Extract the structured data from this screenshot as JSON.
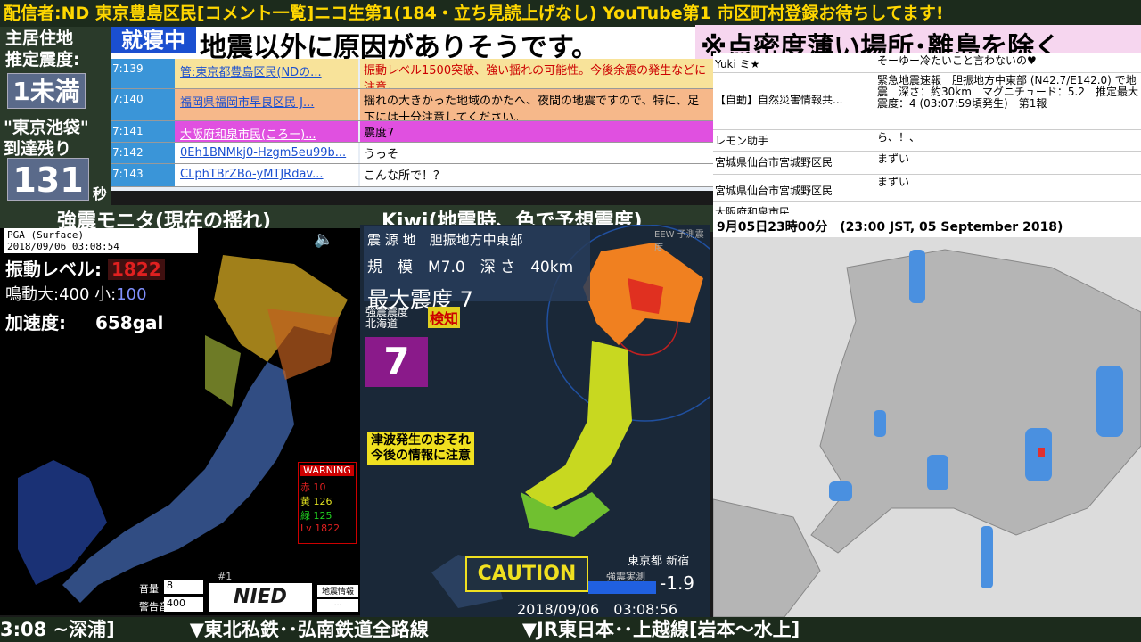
{
  "top_ticker": "配信者:ND 東京豊島区民[コメント一覧]ニコ生第1(184・立ち見読上げなし) YouTube第1 市区町村登録お待ちしてます!",
  "left": {
    "line1": "主居住地",
    "line2": "推定震度:",
    "intensity": "1未満",
    "line3": "\"東京池袋\"",
    "line4": "到達残り",
    "countdown": "131",
    "unit": "秒"
  },
  "banner": {
    "status": "就寝中",
    "message": "地震以外に原因がありそうです。",
    "note": "※点密度薄い場所･離島を除く"
  },
  "comments": [
    {
      "time": "7:139",
      "name": "管:東京都豊島区民(NDの...",
      "msg": "振動レベル1500突破、強い揺れの可能性。今後余震の発生などに注意。",
      "color": "#f4d35e"
    },
    {
      "time": "7:140",
      "name": "福岡県福岡市早良区民 J...",
      "msg": "揺れの大きかった地域のかたへ、夜間の地震ですので、特に、足下には十分注意してください。",
      "color": "#f4a261"
    },
    {
      "time": "7:141",
      "name": "大阪府和泉市民(ころー)...",
      "msg": "震度7",
      "color": "#e040e0"
    },
    {
      "time": "7:142",
      "name": "0Eh1BNMkj0-Hzgm5eu99b...",
      "msg": "うっそ",
      "color": "#ffffff"
    },
    {
      "time": "7:143",
      "name": "CLphTBrZBo-yMTJRdav...",
      "msg": "こんな所で！？",
      "color": "#ffffff"
    }
  ],
  "right_comments": [
    {
      "name": "Yuki ミ★",
      "msg": "そーゆー冷たいこと言わないの♥"
    },
    {
      "name": "【自動】自然災害情報共...",
      "msg": "緊急地震速報　胆振地方中東部 (N42.7/E142.0) で地震　深さ：約30km　マグニチュード：5.2　推定最大震度：4 (03:07:59頃発生)　第1報"
    },
    {
      "name": "レモン助手",
      "msg": "ら、！、"
    },
    {
      "name": "宮城県仙台市宮城野区民",
      "msg": "まずい"
    },
    {
      "name": "宮城県仙台市宮城野区民",
      "msg": "まずい"
    },
    {
      "name": "大阪府和泉市民",
      "msg": ""
    }
  ],
  "sections": {
    "monitor": "強震モニタ(現在の揺れ)",
    "kiwi": "Kiwi(地震時、色で予想震度)"
  },
  "kyoshin": {
    "pga": "PGA (Surface)",
    "datetime": "2018/09/06 03:08:54",
    "level_label": "振動レベル:",
    "level": "1822",
    "sound_label": "鳴動大:400 小:",
    "sound_small": "100",
    "accel_label": "加速度:",
    "accel": "658gal",
    "warning": "WARNING",
    "red": "赤 10",
    "yellow": "黄 126",
    "green": "緑 125",
    "lv": "Lv 1822",
    "volume_label": "音量",
    "volume": "8",
    "alert_label": "警告音",
    "alert": "400",
    "nied": "NIED",
    "hash": "#1",
    "button1": "地震情報",
    "button2": "..."
  },
  "kiwi": {
    "src_label": "震 源 地",
    "src": "胆振地方中東部",
    "mag_label": "規　模",
    "mag": "M7.0",
    "depth_label": "深 さ",
    "depth": "40km",
    "max_label": "最大震度 7",
    "eew": "EEW 予測震度",
    "pref_label": "強震震度\n北海道",
    "detect": "検知",
    "bigseven": "7",
    "tsunami1": "津波発生のおそれ",
    "tsunami2": "今後の情報に注意",
    "caution": "CAUTION",
    "place": "東京都 新宿",
    "measured": "強震実測",
    "value": "-1.9",
    "datetime": "2018/09/06　03:08:56"
  },
  "radar": {
    "header": "9月05日23時00分　(23:00 JST, 05 September 2018)"
  },
  "bottom_ticker": "3:08 ~深浦]　　　　▼東北私鉄･･弘南鉄道全路線　　　　　▼JR東日本･･上越線[岩本～水上]"
}
